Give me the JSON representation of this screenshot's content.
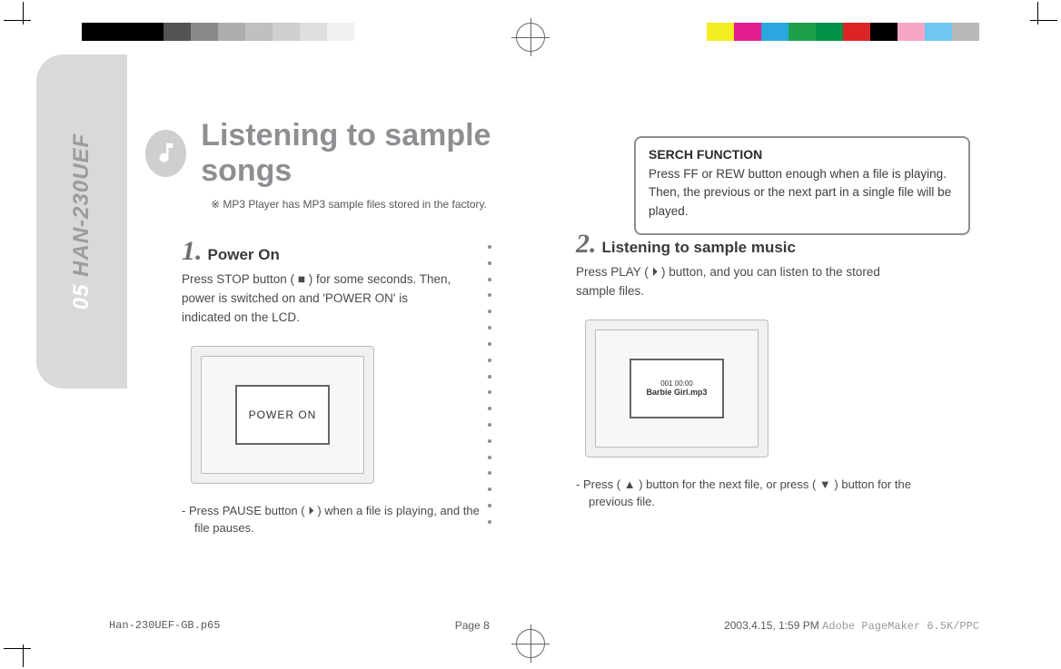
{
  "side": {
    "page_num": "05",
    "model": "HAN-230UEF"
  },
  "header": {
    "title": "Listening to sample songs",
    "noteSymbol": "※",
    "note": "MP3 Player has MP3 sample files stored in the factory."
  },
  "callout": {
    "heading": "SERCH FUNCTION",
    "body": "Press FF or REW button enough when a file is playing. Then, the previous or the next part in a single file will be played."
  },
  "step1": {
    "num": "1.",
    "title": "Power On",
    "body": "Press STOP button ( ■ ) for some seconds. Then, power is switched on and 'POWER ON' is indicated on the LCD.",
    "screen": "POWER ON",
    "bullet": "Press PAUSE button ( ⏵ ) when a file is playing, and the file pauses."
  },
  "step2": {
    "num": "2.",
    "title": "Listening to sample music",
    "body": "Press PLAY ( ⏵ ) button, and you can listen to the stored sample files.",
    "screenLine1": "001     00:00",
    "screenLine2": "Barbie Girl.mp3",
    "bullet": "Press ( ▲ ) button for the next file, or press ( ▼ ) button for the previous file."
  },
  "footer": {
    "filename": "Han-230UEF-GB.p65",
    "page": "Page 8",
    "datetime": "2003.4.15, 1:59 PM",
    "app": "Adobe PageMaker 6.5K/PPC"
  },
  "colorbars": {
    "left": [
      "#000000",
      "#000000",
      "#000000",
      "#545454",
      "#8a8a8a",
      "#aeaeae",
      "#c0c0c0",
      "#cfcfcf",
      "#dedede",
      "#f0f0f0",
      "#ffffff"
    ],
    "right": [
      "#f4ed22",
      "#e51d8e",
      "#2aa7df",
      "#1ea04b",
      "#009247",
      "#dc2426",
      "#000000",
      "#f6a7c8",
      "#6ec7ee",
      "#b9b9bb"
    ]
  }
}
